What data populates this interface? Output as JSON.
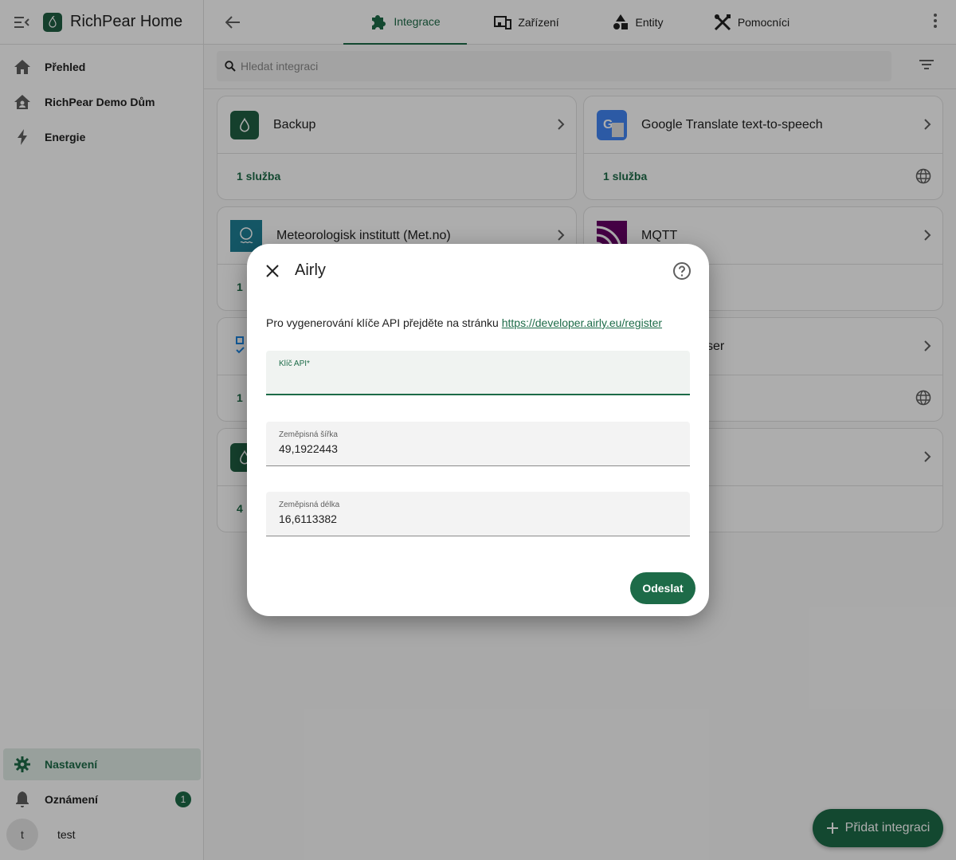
{
  "app": {
    "title": "RichPear Home"
  },
  "sidebar": {
    "items": [
      {
        "label": "Přehled",
        "icon": "home-icon"
      },
      {
        "label": "RichPear Demo Dům",
        "icon": "home-account-icon"
      },
      {
        "label": "Energie",
        "icon": "lightning-icon"
      }
    ],
    "bottom": [
      {
        "label": "Nastavení",
        "icon": "gear-icon",
        "active": true
      },
      {
        "label": "Oznámení",
        "icon": "bell-icon",
        "badge": "1"
      }
    ],
    "user": {
      "initial": "t",
      "name": "test"
    }
  },
  "tabs": [
    {
      "label": "Integrace",
      "icon": "puzzle-icon",
      "active": true
    },
    {
      "label": "Zařízení",
      "icon": "devices-icon"
    },
    {
      "label": "Entity",
      "icon": "shapes-icon"
    },
    {
      "label": "Pomocníci",
      "icon": "tools-icon"
    }
  ],
  "search": {
    "placeholder": "Hledat integraci"
  },
  "cards": [
    {
      "name": "Backup",
      "services": "1 služba",
      "icon": "pear-logo-icon",
      "cloud": false
    },
    {
      "name": "Google Translate text-to-speech",
      "services": "1 služba",
      "icon": "google-translate-icon",
      "cloud": true
    },
    {
      "name": "Meteorologisk institutt (Met.no)",
      "services": "1",
      "icon": "met-no-icon",
      "cloud": false
    },
    {
      "name": "MQTT",
      "services": "",
      "icon": "mqtt-icon",
      "cloud": false
    },
    {
      "name": "",
      "services": "1",
      "icon": "checklist-icon",
      "cloud": false
    },
    {
      "name": "ser",
      "services": "",
      "icon": "",
      "cloud": true
    },
    {
      "name": "",
      "services": "4",
      "icon": "pear-logo-icon",
      "cloud": false
    },
    {
      "name": "",
      "services": "",
      "icon": "",
      "cloud": false
    }
  ],
  "fab": {
    "label": "Přidat integraci"
  },
  "dialog": {
    "title": "Airly",
    "description": "Pro vygenerování klíče API přejděte na stránku ",
    "link": "https://developer.airly.eu/register",
    "fields": [
      {
        "label": "Klíč API*",
        "value": ""
      },
      {
        "label": "Zeměpisná šířka",
        "value": "49,1922443"
      },
      {
        "label": "Zeměpisná délka",
        "value": "16,6113382"
      }
    ],
    "submit_label": "Odeslat"
  },
  "colors": {
    "accent": "#1d6b48",
    "active_bg": "#e1ece6"
  }
}
